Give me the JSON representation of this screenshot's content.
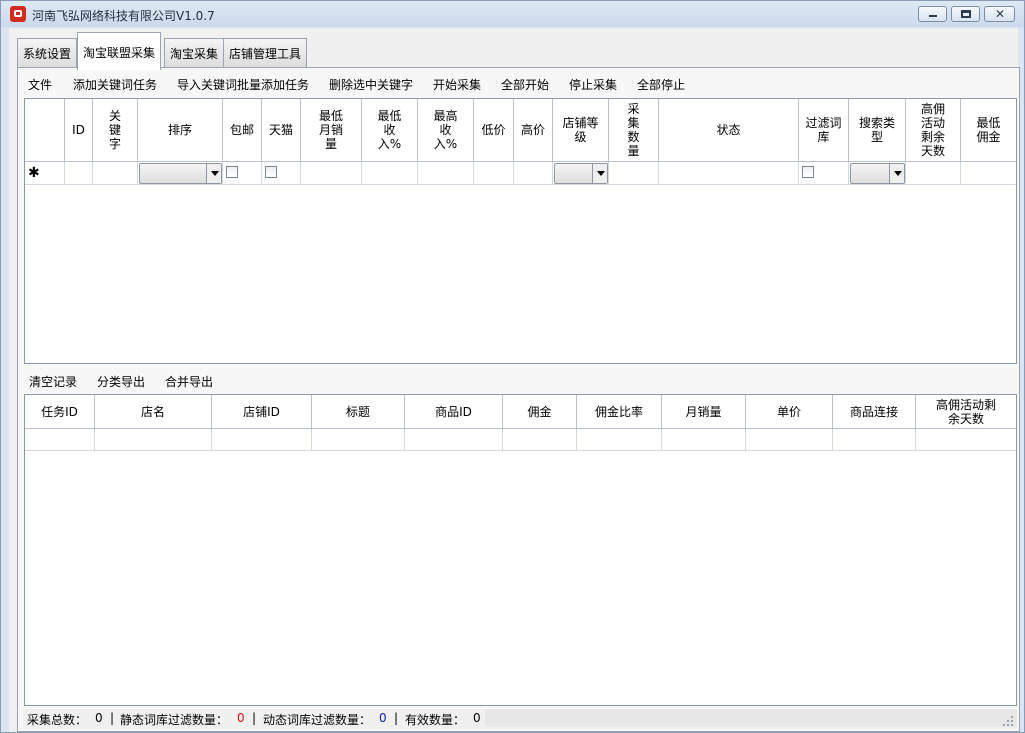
{
  "window": {
    "title": "河南飞弘网络科技有限公司V1.0.7",
    "minimize": "",
    "maximize": "",
    "close": "✕"
  },
  "tabs": [
    "系统设置",
    "淘宝联盟采集",
    "淘宝采集",
    "店铺管理工具"
  ],
  "active_tab": "淘宝联盟采集",
  "toolbar1": [
    "文件",
    "添加关键词任务",
    "导入关键词批量添加任务",
    "删除选中关键字",
    "开始采集",
    "全部开始",
    "停止采集",
    "全部停止"
  ],
  "task_grid": {
    "columns": [
      {
        "label": ""
      },
      {
        "label": "ID"
      },
      {
        "label": "关\n键\n字"
      },
      {
        "label": "排序"
      },
      {
        "label": "包邮"
      },
      {
        "label": "天猫"
      },
      {
        "label": "最低\n月销\n量"
      },
      {
        "label": "最低\n收\n入%"
      },
      {
        "label": "最高\n收\n入%"
      },
      {
        "label": "低价"
      },
      {
        "label": "高价"
      },
      {
        "label": "店铺等\n级"
      },
      {
        "label": "采\n集\n数\n量"
      },
      {
        "label": "状态"
      },
      {
        "label": "过滤词\n库"
      },
      {
        "label": "搜索类\n型"
      },
      {
        "label": "高佣\n活动\n剩余\n天数"
      },
      {
        "label": "最低\n佣金"
      }
    ],
    "new_row_marker": "✱"
  },
  "toolbar2": [
    "清空记录",
    "分类导出",
    "合并导出"
  ],
  "result_grid": {
    "columns": [
      "任务ID",
      "店名",
      "店铺ID",
      "标题",
      "商品ID",
      "佣金",
      "佣金比率",
      "月销量",
      "单价",
      "商品连接",
      "高佣活动剩\n余天数"
    ]
  },
  "status": {
    "total_label": "采集总数：",
    "total_value": "0",
    "static_label": "静态词库过滤数量：",
    "static_value": "0",
    "dynamic_label": "动态词库过滤数量：",
    "dynamic_value": "0",
    "valid_label": "有效数量：",
    "valid_value": "0",
    "separator": "|"
  },
  "colors": {
    "static_value": "#e01010",
    "dynamic_value": "#1020c0"
  }
}
